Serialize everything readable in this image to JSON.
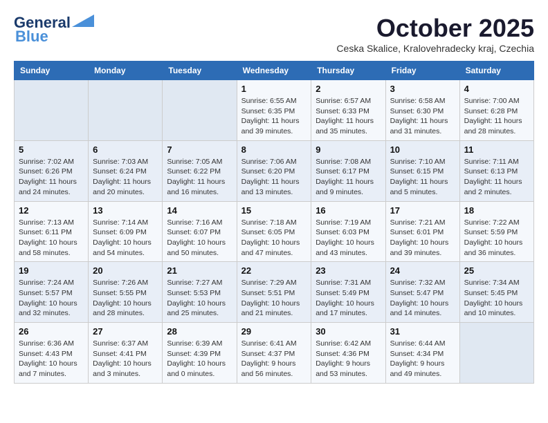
{
  "header": {
    "logo_line1": "General",
    "logo_line2": "Blue",
    "month": "October 2025",
    "location": "Ceska Skalice, Kralovehradecky kraj, Czechia"
  },
  "weekdays": [
    "Sunday",
    "Monday",
    "Tuesday",
    "Wednesday",
    "Thursday",
    "Friday",
    "Saturday"
  ],
  "weeks": [
    [
      {
        "day": "",
        "info": ""
      },
      {
        "day": "",
        "info": ""
      },
      {
        "day": "",
        "info": ""
      },
      {
        "day": "1",
        "info": "Sunrise: 6:55 AM\nSunset: 6:35 PM\nDaylight: 11 hours and 39 minutes."
      },
      {
        "day": "2",
        "info": "Sunrise: 6:57 AM\nSunset: 6:33 PM\nDaylight: 11 hours and 35 minutes."
      },
      {
        "day": "3",
        "info": "Sunrise: 6:58 AM\nSunset: 6:30 PM\nDaylight: 11 hours and 31 minutes."
      },
      {
        "day": "4",
        "info": "Sunrise: 7:00 AM\nSunset: 6:28 PM\nDaylight: 11 hours and 28 minutes."
      }
    ],
    [
      {
        "day": "5",
        "info": "Sunrise: 7:02 AM\nSunset: 6:26 PM\nDaylight: 11 hours and 24 minutes."
      },
      {
        "day": "6",
        "info": "Sunrise: 7:03 AM\nSunset: 6:24 PM\nDaylight: 11 hours and 20 minutes."
      },
      {
        "day": "7",
        "info": "Sunrise: 7:05 AM\nSunset: 6:22 PM\nDaylight: 11 hours and 16 minutes."
      },
      {
        "day": "8",
        "info": "Sunrise: 7:06 AM\nSunset: 6:20 PM\nDaylight: 11 hours and 13 minutes."
      },
      {
        "day": "9",
        "info": "Sunrise: 7:08 AM\nSunset: 6:17 PM\nDaylight: 11 hours and 9 minutes."
      },
      {
        "day": "10",
        "info": "Sunrise: 7:10 AM\nSunset: 6:15 PM\nDaylight: 11 hours and 5 minutes."
      },
      {
        "day": "11",
        "info": "Sunrise: 7:11 AM\nSunset: 6:13 PM\nDaylight: 11 hours and 2 minutes."
      }
    ],
    [
      {
        "day": "12",
        "info": "Sunrise: 7:13 AM\nSunset: 6:11 PM\nDaylight: 10 hours and 58 minutes."
      },
      {
        "day": "13",
        "info": "Sunrise: 7:14 AM\nSunset: 6:09 PM\nDaylight: 10 hours and 54 minutes."
      },
      {
        "day": "14",
        "info": "Sunrise: 7:16 AM\nSunset: 6:07 PM\nDaylight: 10 hours and 50 minutes."
      },
      {
        "day": "15",
        "info": "Sunrise: 7:18 AM\nSunset: 6:05 PM\nDaylight: 10 hours and 47 minutes."
      },
      {
        "day": "16",
        "info": "Sunrise: 7:19 AM\nSunset: 6:03 PM\nDaylight: 10 hours and 43 minutes."
      },
      {
        "day": "17",
        "info": "Sunrise: 7:21 AM\nSunset: 6:01 PM\nDaylight: 10 hours and 39 minutes."
      },
      {
        "day": "18",
        "info": "Sunrise: 7:22 AM\nSunset: 5:59 PM\nDaylight: 10 hours and 36 minutes."
      }
    ],
    [
      {
        "day": "19",
        "info": "Sunrise: 7:24 AM\nSunset: 5:57 PM\nDaylight: 10 hours and 32 minutes."
      },
      {
        "day": "20",
        "info": "Sunrise: 7:26 AM\nSunset: 5:55 PM\nDaylight: 10 hours and 28 minutes."
      },
      {
        "day": "21",
        "info": "Sunrise: 7:27 AM\nSunset: 5:53 PM\nDaylight: 10 hours and 25 minutes."
      },
      {
        "day": "22",
        "info": "Sunrise: 7:29 AM\nSunset: 5:51 PM\nDaylight: 10 hours and 21 minutes."
      },
      {
        "day": "23",
        "info": "Sunrise: 7:31 AM\nSunset: 5:49 PM\nDaylight: 10 hours and 17 minutes."
      },
      {
        "day": "24",
        "info": "Sunrise: 7:32 AM\nSunset: 5:47 PM\nDaylight: 10 hours and 14 minutes."
      },
      {
        "day": "25",
        "info": "Sunrise: 7:34 AM\nSunset: 5:45 PM\nDaylight: 10 hours and 10 minutes."
      }
    ],
    [
      {
        "day": "26",
        "info": "Sunrise: 6:36 AM\nSunset: 4:43 PM\nDaylight: 10 hours and 7 minutes."
      },
      {
        "day": "27",
        "info": "Sunrise: 6:37 AM\nSunset: 4:41 PM\nDaylight: 10 hours and 3 minutes."
      },
      {
        "day": "28",
        "info": "Sunrise: 6:39 AM\nSunset: 4:39 PM\nDaylight: 10 hours and 0 minutes."
      },
      {
        "day": "29",
        "info": "Sunrise: 6:41 AM\nSunset: 4:37 PM\nDaylight: 9 hours and 56 minutes."
      },
      {
        "day": "30",
        "info": "Sunrise: 6:42 AM\nSunset: 4:36 PM\nDaylight: 9 hours and 53 minutes."
      },
      {
        "day": "31",
        "info": "Sunrise: 6:44 AM\nSunset: 4:34 PM\nDaylight: 9 hours and 49 minutes."
      },
      {
        "day": "",
        "info": ""
      }
    ]
  ]
}
